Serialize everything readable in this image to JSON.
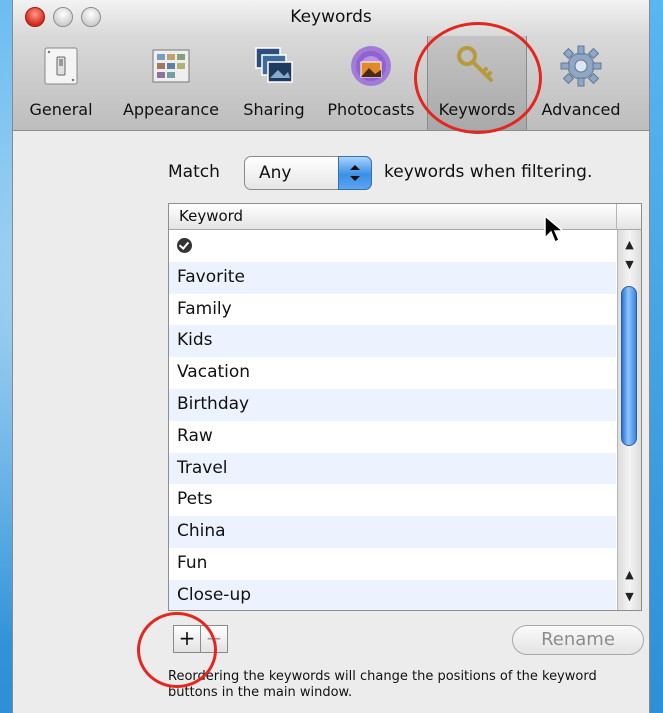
{
  "window": {
    "title": "Keywords"
  },
  "toolbar": {
    "items": [
      {
        "label": "General",
        "icon": "light-switch-icon"
      },
      {
        "label": "Appearance",
        "icon": "appearance-icon"
      },
      {
        "label": "Sharing",
        "icon": "sharing-photos-icon"
      },
      {
        "label": "Photocasts",
        "icon": "photocast-icon"
      },
      {
        "label": "Keywords",
        "icon": "key-icon"
      },
      {
        "label": "Advanced",
        "icon": "gear-icon"
      }
    ],
    "selected": "Keywords"
  },
  "match": {
    "prefix": "Match",
    "value": "Any",
    "suffix": "keywords when filtering."
  },
  "table": {
    "header": "Keyword",
    "rows": [
      "",
      "Favorite",
      "Family",
      "Kids",
      "Vacation",
      "Birthday",
      "Raw",
      "Travel",
      "Pets",
      "China",
      "Fun",
      "Close-up"
    ]
  },
  "buttons": {
    "add": "+",
    "remove": "−",
    "rename": "Rename"
  },
  "note": "Reordering the keywords will change the positions of the keyword buttons in the main window.",
  "colors": {
    "annotation_ring": "#e3261e",
    "scroll_thumb": "#3d86de"
  }
}
